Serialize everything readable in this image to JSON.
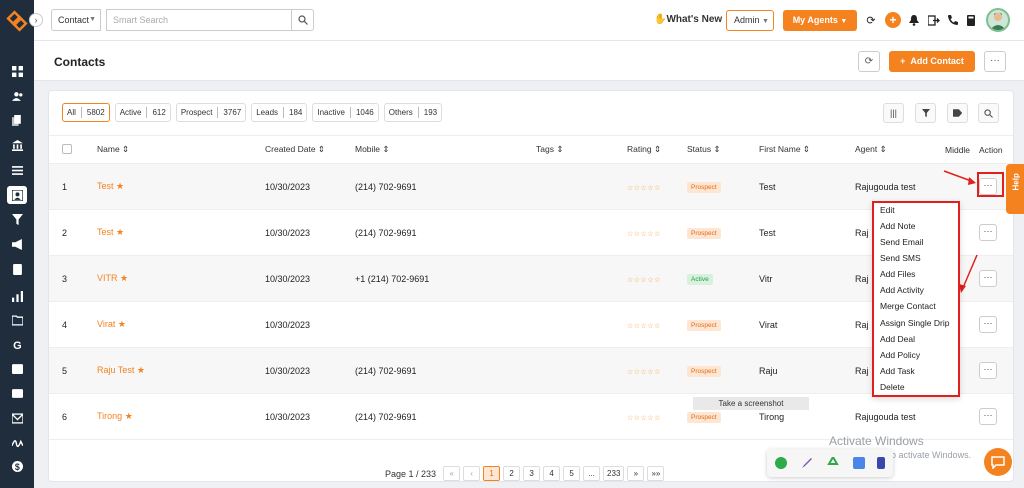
{
  "topbar": {
    "search_type": "Contact",
    "search_placeholder": "Smart Search",
    "whats_new": "What's New",
    "admin_label": "Admin",
    "my_agents_label": "My Agents"
  },
  "page": {
    "title": "Contacts",
    "add_contact_label": "Add Contact"
  },
  "filters": [
    {
      "label": "All",
      "count": "5802"
    },
    {
      "label": "Active",
      "count": "612"
    },
    {
      "label": "Prospect",
      "count": "3767"
    },
    {
      "label": "Leads",
      "count": "184"
    },
    {
      "label": "Inactive",
      "count": "1046"
    },
    {
      "label": "Others",
      "count": "193"
    }
  ],
  "table": {
    "headers": {
      "name": "Name",
      "created": "Created Date",
      "mobile": "Mobile",
      "tags": "Tags",
      "rating": "Rating",
      "status": "Status",
      "first_name": "First Name",
      "agent": "Agent",
      "middle": "Middle",
      "action": "Action"
    },
    "rows": [
      {
        "num": "1",
        "name": "Test",
        "created": "10/30/2023",
        "mobile": "(214) 702-9691",
        "status": "Prospect",
        "status_type": "prospect",
        "first_name": "Test",
        "agent": "Rajugouda test"
      },
      {
        "num": "2",
        "name": "Test",
        "created": "10/30/2023",
        "mobile": "(214) 702-9691",
        "status": "Prospect",
        "status_type": "prospect",
        "first_name": "Test",
        "agent": "Raj"
      },
      {
        "num": "3",
        "name": "VITR",
        "created": "10/30/2023",
        "mobile": "+1 (214) 702-9691",
        "status": "Active",
        "status_type": "active",
        "first_name": "Vitr",
        "agent": "Raj"
      },
      {
        "num": "4",
        "name": "Virat",
        "created": "10/30/2023",
        "mobile": "",
        "status": "Prospect",
        "status_type": "prospect",
        "first_name": "Virat",
        "agent": "Raj"
      },
      {
        "num": "5",
        "name": "Raju Test",
        "created": "10/30/2023",
        "mobile": "(214) 702-9691",
        "status": "Prospect",
        "status_type": "prospect",
        "first_name": "Raju",
        "agent": "Raj"
      },
      {
        "num": "6",
        "name": "Tirong",
        "created": "10/30/2023",
        "mobile": "(214) 702-9691",
        "status": "Prospect",
        "status_type": "prospect",
        "first_name": "Tirong",
        "agent": "Rajugouda test"
      }
    ]
  },
  "action_menu": [
    "Edit",
    "Add Note",
    "Send Email",
    "Send SMS",
    "Add Files",
    "Add Activity",
    "Merge Contact",
    "Assign Single Drip",
    "Add Deal",
    "Add Policy",
    "Add Task",
    "Delete"
  ],
  "pagination": {
    "info": "Page 1 / 233",
    "first": "«",
    "prev": "‹",
    "pages": [
      "1",
      "2",
      "3",
      "4",
      "5",
      "...",
      "233"
    ],
    "next": "»",
    "last": "»»"
  },
  "help_label": "Help",
  "tooltip": "Take a screenshot",
  "windows_notice": {
    "title": "Activate Windows",
    "subtitle": "Go to Settings to activate Windows."
  },
  "colors": {
    "brand": "#f4821f",
    "sidebar": "#1f2d3d",
    "highlight": "#e0201c"
  }
}
